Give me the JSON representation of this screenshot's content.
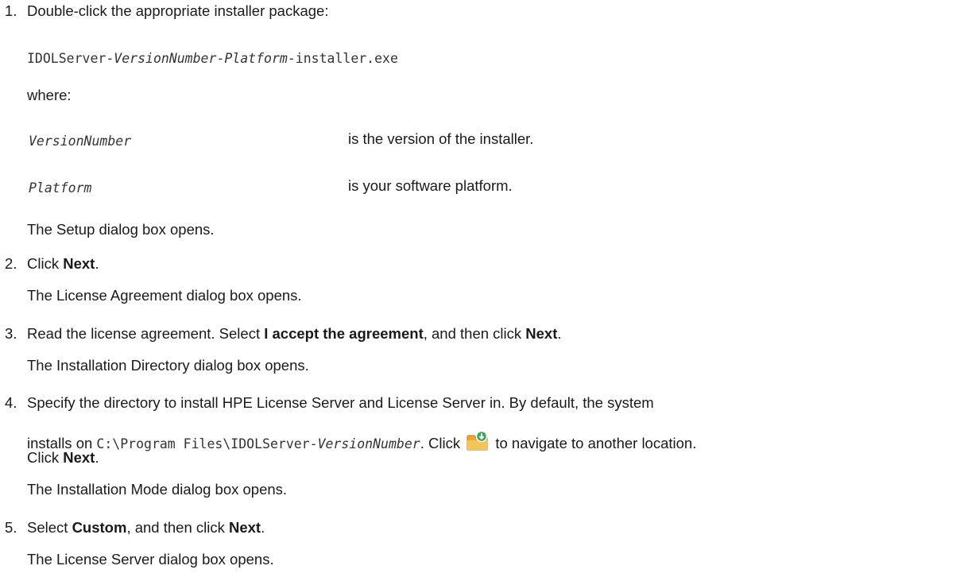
{
  "step1": {
    "num": "1.",
    "text": "Double-click the appropriate installer package:",
    "pkg_a": "IDOLServer-",
    "pkg_b": "VersionNumber",
    "pkg_c": "-",
    "pkg_d": "Platform",
    "pkg_e": "-installer.exe",
    "where": "where:",
    "defs": [
      {
        "term": "VersionNumber",
        "desc": "is the version of the installer."
      },
      {
        "term": "Platform",
        "desc": "is your software platform."
      }
    ],
    "result": "The Setup dialog box opens."
  },
  "step2": {
    "num": "2.",
    "a": "Click ",
    "b": "Next",
    "c": ".",
    "result": "The License Agreement dialog box opens."
  },
  "step3": {
    "num": "3.",
    "a": "Read the license agreement. Select ",
    "b": "I accept the agreement",
    "c": ", and then click ",
    "d": "Next",
    "e": ".",
    "result": "The Installation Directory dialog box opens."
  },
  "step4": {
    "num": "4.",
    "line1": "Specify the directory to install HPE License Server and License Server in. By default, the system",
    "line2_a": "installs on ",
    "line2_b": "C:\\Program Files\\IDOLServer-",
    "line2_c": "VersionNumber",
    "line2_d": ". Click ",
    "line2_icon": "folder-browse-icon",
    "line2_e": " to navigate to another location.",
    "line3_a": "Click ",
    "line3_b": "Next",
    "line3_c": ".",
    "result": "The Installation Mode dialog box opens."
  },
  "step5": {
    "num": "5.",
    "a": "Select ",
    "b": "Custom",
    "c": ", and then click ",
    "d": "Next",
    "e": ".",
    "result": "The License Server dialog box opens."
  }
}
